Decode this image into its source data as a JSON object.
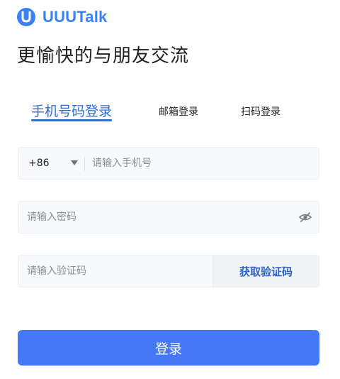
{
  "brand": {
    "name": "UUUTalk",
    "logo_icon": "uuutalk-logo-icon",
    "color": "#3b82f6"
  },
  "headline": "更愉快的与朋友交流",
  "tabs": {
    "phone": "手机号码登录",
    "email": "邮箱登录",
    "scan": "扫码登录",
    "active": "phone",
    "active_color": "#2f6fd6"
  },
  "phone": {
    "country_code": "+86",
    "placeholder": "请输入手机号"
  },
  "password": {
    "placeholder": "请输入密码",
    "toggle_icon": "eye-off-icon"
  },
  "code": {
    "placeholder": "请输入验证码",
    "get_code_label": "获取验证码"
  },
  "login_button": {
    "label": "登录",
    "color": "#4677f5"
  }
}
